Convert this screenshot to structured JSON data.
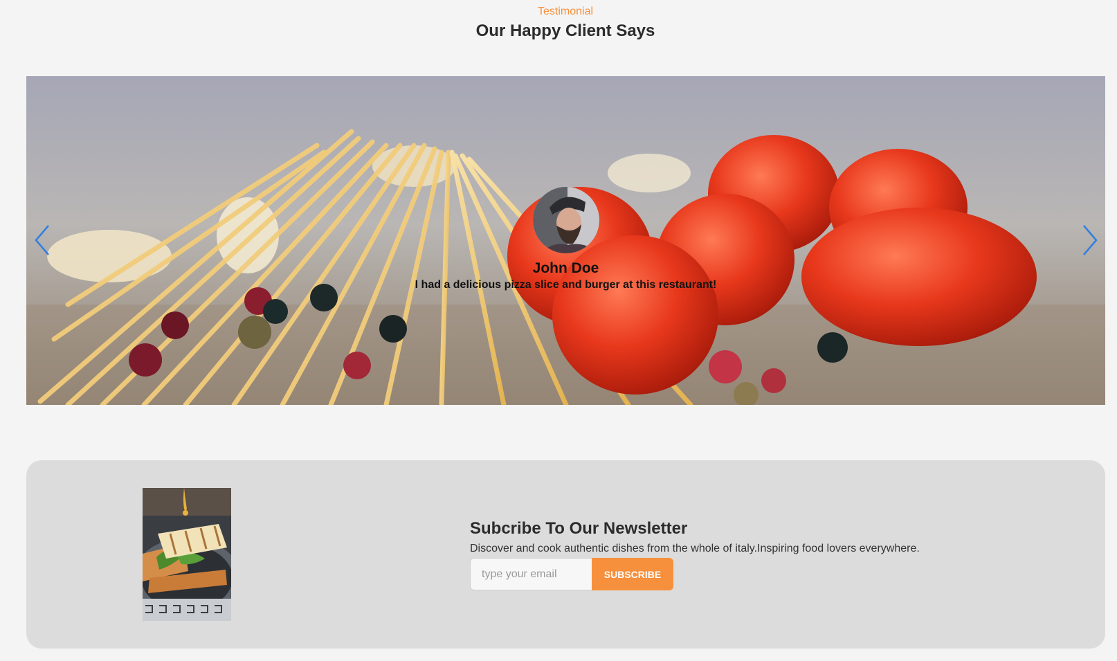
{
  "testimonial": {
    "eyebrow": "Testimonial",
    "title": "Our Happy Client Says",
    "slide": {
      "client_name": "John Doe",
      "quote": "I had a delicious pizza slice and burger at this restaurant!"
    },
    "arrows": {
      "prev_icon": "chevron-left-icon",
      "next_icon": "chevron-right-icon"
    }
  },
  "newsletter": {
    "title": "Subcribe To Our Newsletter",
    "description": "Discover and cook authentic dishes from the whole of italy.Inspiring food lovers everywhere.",
    "email_placeholder": "type your email",
    "subscribe_label": "SUBSCRIBE"
  },
  "colors": {
    "accent": "#f6903d",
    "arrow": "#2f7fe0",
    "page_bg": "#f4f4f4",
    "newsletter_bg": "#dcdcdc"
  }
}
